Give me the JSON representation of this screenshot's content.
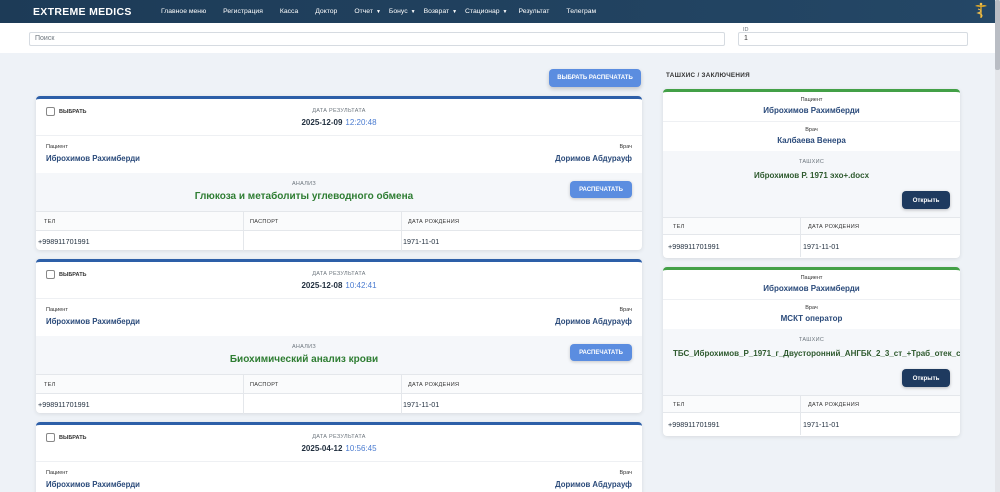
{
  "navbar": {
    "brand": "EXTREME MEDICS",
    "items": [
      {
        "label": "Главное меню",
        "caret": false
      },
      {
        "label": "Регистрация",
        "caret": false
      },
      {
        "label": "Касса",
        "caret": false
      },
      {
        "label": "Доктор",
        "caret": false
      },
      {
        "label": "Отчет",
        "caret": true
      },
      {
        "label": "Бонус",
        "caret": true
      },
      {
        "label": "Возврат",
        "caret": true
      },
      {
        "label": "Стационар",
        "caret": true
      },
      {
        "label": "Результат",
        "caret": false
      },
      {
        "label": "Телеграм",
        "caret": false
      }
    ]
  },
  "search": {
    "placeholder": "Поиск",
    "id_label": "ID",
    "id_value": "1"
  },
  "print_selected_label": "ВЫБРАТЬ РАСПЕЧАТАТЬ",
  "results": [
    {
      "select_label": "ВЫБРАТЬ",
      "date_label": "ДАТА РЕЗУЛЬТАТА",
      "date": "2025-12-09",
      "time": "12:20:48",
      "patient_label": "Пациент",
      "patient": "Иброхимов Рахимберди",
      "doctor_label": "Врач",
      "doctor": "Доримов Абдурауф",
      "analysis_label": "АНАЛИЗ",
      "analysis": "Глюкоза и метаболиты углеводного обмена",
      "print_label": "РАСПЕЧАТАТЬ",
      "phone_label": "ТЕЛ",
      "passport_label": "ПАСПОРТ",
      "birth_label": "ДАТА РОЖДЕНИЯ",
      "phone": "+998911701991",
      "passport": "",
      "birth": "1971-11-01"
    },
    {
      "select_label": "ВЫБРАТЬ",
      "date_label": "ДАТА РЕЗУЛЬТАТА",
      "date": "2025-12-08",
      "time": "10:42:41",
      "patient_label": "Пациент",
      "patient": "Иброхимов Рахимберди",
      "doctor_label": "Врач",
      "doctor": "Доримов Абдурауф",
      "analysis_label": "АНАЛИЗ",
      "analysis": "Биохимический анализ крови",
      "print_label": "РАСПЕЧАТАТЬ",
      "phone_label": "ТЕЛ",
      "passport_label": "ПАСПОРТ",
      "birth_label": "ДАТА РОЖДЕНИЯ",
      "phone": "+998911701991",
      "passport": "",
      "birth": "1971-11-01"
    },
    {
      "select_label": "ВЫБРАТЬ",
      "date_label": "ДАТА РЕЗУЛЬТАТА",
      "date": "2025-04-12",
      "time": "10:56:45",
      "patient_label": "Пациент",
      "patient": "Иброхимов Рахимберди",
      "doctor_label": "Врач",
      "doctor": "Доримов Абдурауф"
    }
  ],
  "diagnoses": {
    "title": "ТАШХИС / ЗАКЛЮЧЕНИЯ",
    "items": [
      {
        "patient_label": "Пациент",
        "patient": "Иброхимов Рахимберди",
        "doctor_label": "Врач",
        "doctor": "Калбаева Венера",
        "diag_label": "ТАШХИС",
        "diag": "Иброхимов Р. 1971 эхо+.docx",
        "open_label": "Открыть",
        "phone_label": "ТЕЛ",
        "birth_label": "ДАТА РОЖДЕНИЯ",
        "phone": "+998911701991",
        "birth": "1971-11-01"
      },
      {
        "patient_label": "Пациент",
        "patient": "Иброхимов Рахимберди",
        "doctor_label": "Врач",
        "doctor": "МСКТ оператор",
        "diag_label": "ТАШХИС",
        "diag": "ТБС_Иброхимов_Р_1971_г_Двусторонний_АНГБК_2_3_ст_+Траб_отек_с",
        "open_label": "Открыть",
        "phone_label": "ТЕЛ",
        "birth_label": "ДАТА РОЖДЕНИЯ",
        "phone": "+998911701991",
        "birth": "1971-11-01"
      }
    ]
  }
}
